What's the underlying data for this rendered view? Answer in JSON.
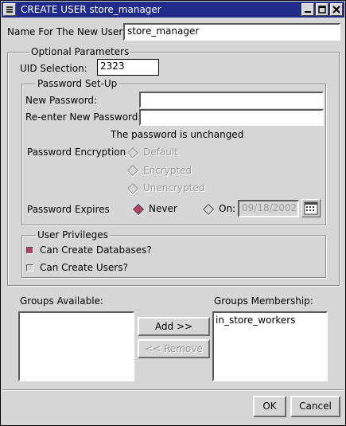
{
  "window": {
    "title": "CREATE USER store_manager",
    "controls": [
      "minimize-icon",
      "maximize-icon",
      "close-icon"
    ]
  },
  "name_field": {
    "label": "Name For The New User:",
    "value": "store_manager"
  },
  "optional": {
    "title": "Optional Parameters",
    "uid_label": "UID Selection:",
    "uid_value": "2323"
  },
  "password": {
    "title": "Password Set-Up",
    "new_label": "New Password:",
    "new_value": "",
    "reenter_label": "Re-enter New Password:",
    "reenter_value": "",
    "status": "The password is unchanged",
    "encryption_label": "Password Encryption",
    "encryption_options": [
      "Default",
      "Encrypted",
      "Unencrypted"
    ],
    "expires_label": "Password Expires",
    "never_label": "Never",
    "on_label": "On:",
    "date_value": "09/18/2002",
    "selected_expiry": "Never"
  },
  "privileges": {
    "title": "User Privileges",
    "create_db_label": "Can Create Databases?",
    "create_db_checked": true,
    "create_users_label": "Can Create Users?",
    "create_users_checked": false
  },
  "groups": {
    "available_label": "Groups Available:",
    "available_items": [],
    "add_label": "Add >>",
    "remove_label": "<< Remove",
    "membership_label": "Groups Membership:",
    "membership_items": [
      "in_store_workers"
    ]
  },
  "footer": {
    "ok_label": "OK",
    "cancel_label": "Cancel"
  },
  "colors": {
    "titlebar": "#202b8a",
    "selected": "#b24060",
    "background": "#d6d6d6"
  }
}
